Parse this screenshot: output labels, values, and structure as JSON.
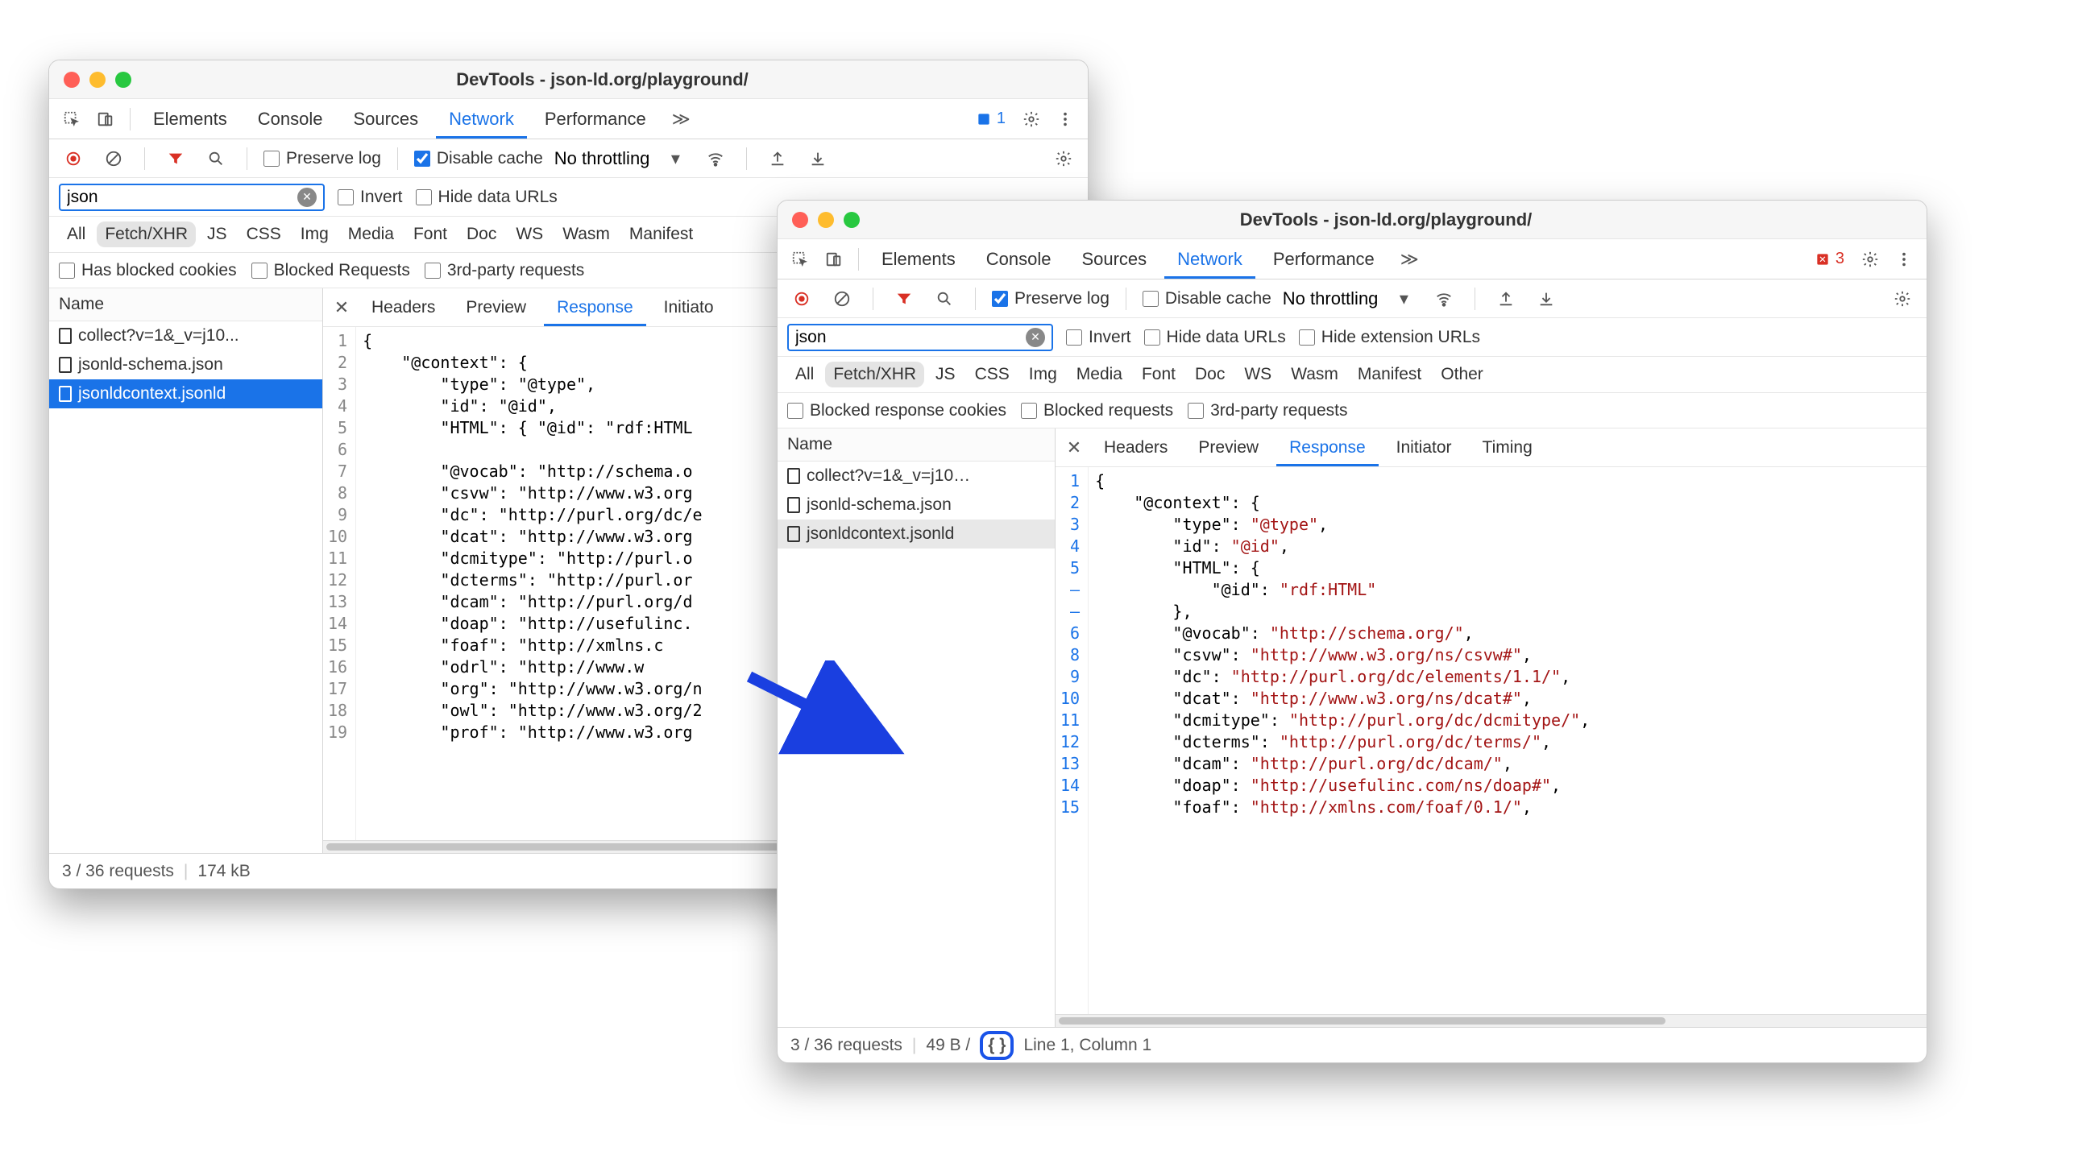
{
  "title": "DevTools - json-ld.org/playground/",
  "tabs": {
    "elements": "Elements",
    "console": "Console",
    "sources": "Sources",
    "network": "Network",
    "performance": "Performance"
  },
  "issues1": "1",
  "issues2": "3",
  "preserve": "Preserve log",
  "disable": "Disable cache",
  "throttle": "No throttling",
  "search": "json",
  "invert": "Invert",
  "hideurl": "Hide data URLs",
  "hideext": "Hide extension URLs",
  "ftypes": {
    "all": "All",
    "fetch": "Fetch/XHR",
    "js": "JS",
    "css": "CSS",
    "img": "Img",
    "media": "Media",
    "font": "Font",
    "doc": "Doc",
    "ws": "WS",
    "wasm": "Wasm",
    "manifest": "Manifest",
    "other": "Other"
  },
  "blocked1": "Has blocked cookies",
  "blocked1b": "Blocked Requests",
  "third": "3rd-party requests",
  "blocked2": "Blocked response cookies",
  "blocked2b": "Blocked requests",
  "namecol": "Name",
  "reqs": {
    "r1": "collect?v=1&_v=j10...",
    "r1b": "collect?v=1&_v=j10…",
    "r2": "jsonld-schema.json",
    "r3": "jsonldcontext.jsonld"
  },
  "dtabs": {
    "headers": "Headers",
    "preview": "Preview",
    "response": "Response",
    "initiator": "Initiator",
    "initiator_cut": "Initiato",
    "timing": "Timing"
  },
  "status": {
    "req": "3 / 36 requests",
    "size1": "174 kB",
    "size2": "49 B /",
    "pos": "Line 1, Column 1"
  },
  "code1": {
    "lines": [
      "1",
      "2",
      "3",
      "4",
      "5",
      "6",
      "7",
      "8",
      "9",
      "10",
      "11",
      "12",
      "13",
      "14",
      "15",
      "16",
      "17",
      "18",
      "19"
    ],
    "body": "{\n    \"@context\": {\n        \"type\": \"@type\",\n        \"id\": \"@id\",\n        \"HTML\": { \"@id\": \"rdf:HTML\n\n        \"@vocab\": \"http://schema.o\n        \"csvw\": \"http://www.w3.org\n        \"dc\": \"http://purl.org/dc/e\n        \"dcat\": \"http://www.w3.org\n        \"dcmitype\": \"http://purl.o\n        \"dcterms\": \"http://purl.or\n        \"dcam\": \"http://purl.org/d\n        \"doap\": \"http://usefulinc.\n        \"foaf\": \"http://xmlns.c\n        \"odrl\": \"http://www.w\n        \"org\": \"http://www.w3.org/n\n        \"owl\": \"http://www.w3.org/2\n        \"prof\": \"http://www.w3.org"
  },
  "code2": {
    "lines": [
      "1",
      "2",
      "3",
      "4",
      "5",
      "–",
      "–",
      "6",
      "8",
      "9",
      "10",
      "11",
      "12",
      "13",
      "14",
      "15"
    ]
  }
}
